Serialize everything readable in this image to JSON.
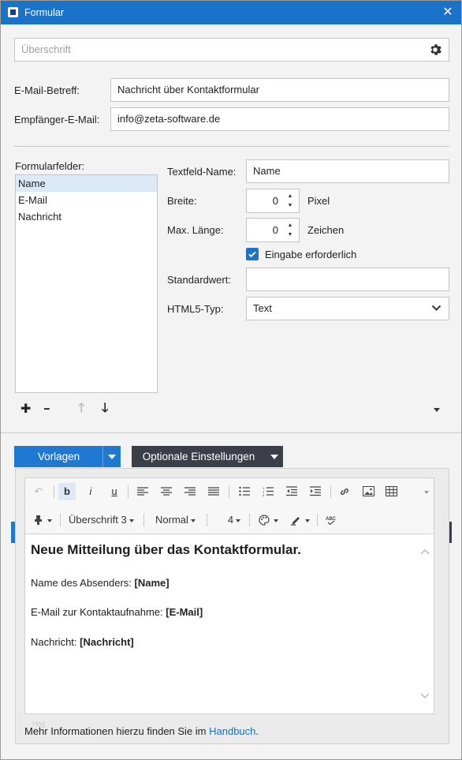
{
  "window": {
    "title": "Formular",
    "close_symbol": "✕"
  },
  "heading_field": {
    "placeholder": "Überschrift"
  },
  "email_subject": {
    "label": "E-Mail-Betreff:",
    "value": "Nachricht über Kontaktformular"
  },
  "recipient": {
    "label": "Empfänger-E-Mail:",
    "value": "info@zeta-software.de"
  },
  "form_fields": {
    "label": "Formularfelder:",
    "items": [
      "Name",
      "E-Mail",
      "Nachricht"
    ],
    "selected": "Name"
  },
  "field_props": {
    "textfield_name_label": "Textfeld-Name:",
    "textfield_name_value": "Name",
    "width_label": "Breite:",
    "width_value": "0",
    "width_unit": "Pixel",
    "maxlen_label": "Max. Länge:",
    "maxlen_value": "0",
    "maxlen_unit": "Zeichen",
    "required_label": "Eingabe erforderlich",
    "required_checked": true,
    "default_label": "Standardwert:",
    "default_value": "",
    "html5_label": "HTML5-Typ:",
    "html5_value": "Text"
  },
  "list_controls": {
    "add": "✚",
    "remove": "━",
    "up": "🡑",
    "down": "🡓"
  },
  "buttons": {
    "templates": "Vorlagen",
    "optional": "Optionale Einstellungen"
  },
  "toolbar": {
    "undo": "↶",
    "bold": "b",
    "italic": "i",
    "underline": "u",
    "heading_style": "Überschrift 3",
    "font_style": "Normal",
    "font_size": "4"
  },
  "editor": {
    "heading": "Neue Mitteilung über das Kontaktformular.",
    "line1_label": "Name des Absenders: ",
    "line1_value": "[Name]",
    "line2_label": "E-Mail zur Kontaktaufnahme: ",
    "line2_value": "[E-Mail]",
    "line3_label": "Nachricht: ",
    "line3_value": "[Nachricht]"
  },
  "footer": {
    "text": "Mehr Informationen hierzu finden Sie im ",
    "link": "Handbuch",
    "end": "."
  },
  "ghost_text": "Hog"
}
